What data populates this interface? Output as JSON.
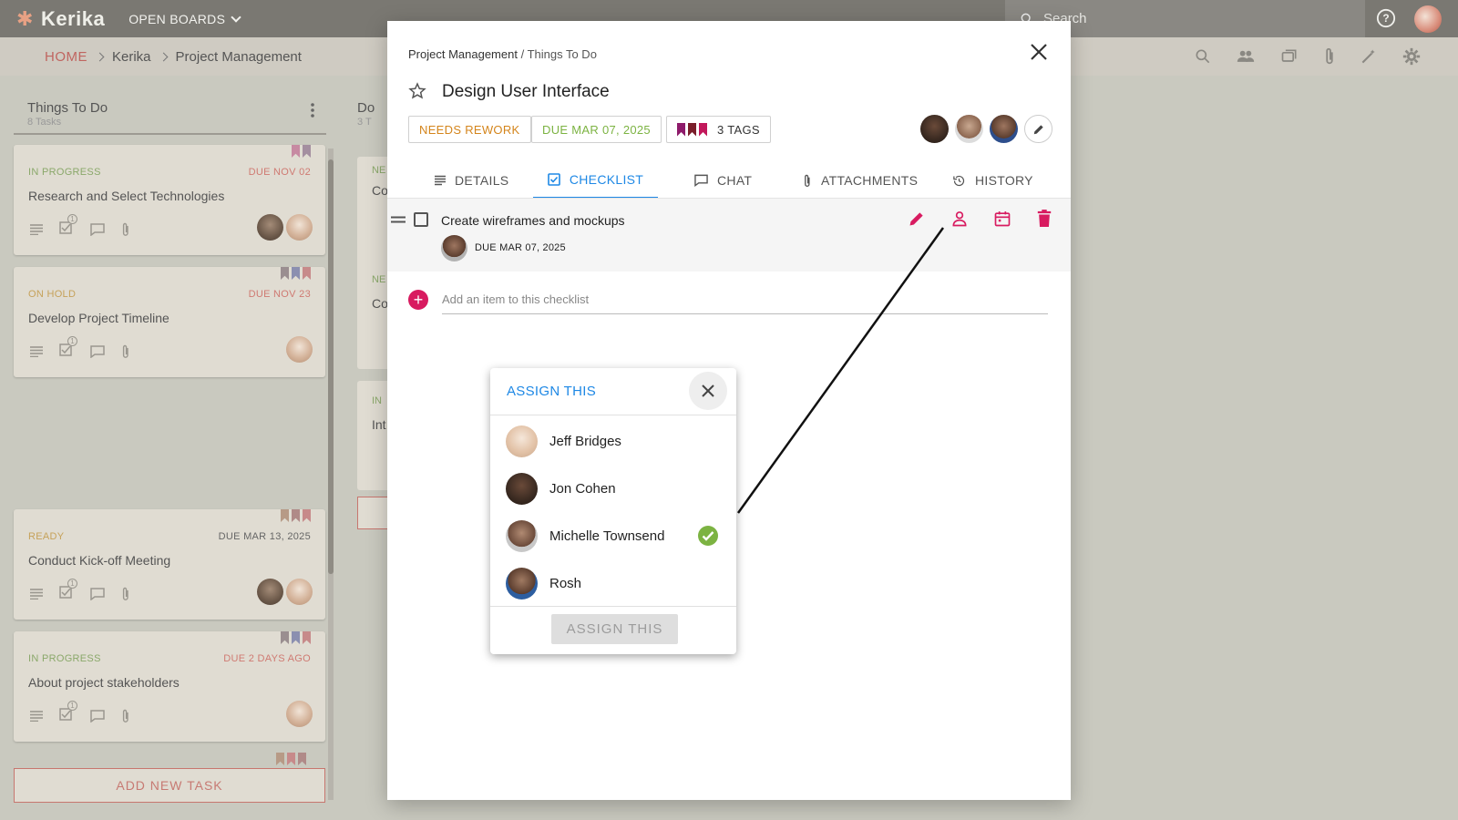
{
  "app": {
    "logo_text": "Kerika",
    "open_boards_label": "OPEN BOARDS",
    "search_placeholder": "Search"
  },
  "breadcrumb": {
    "home": "HOME",
    "org": "Kerika",
    "board": "Project Management"
  },
  "column": {
    "title": "Things To Do",
    "count": "8 Tasks",
    "cards": [
      {
        "status": "IN PROGRESS",
        "due": "DUE NOV 02",
        "title": "Research and Select Technologies",
        "checklist_count": "1"
      },
      {
        "status": "ON HOLD",
        "due": "DUE NOV 23",
        "title": "Develop Project Timeline",
        "checklist_count": "1"
      },
      {
        "status": "READY",
        "due": "DUE MAR 13, 2025",
        "title": "Conduct Kick-off Meeting",
        "checklist_count": "1"
      },
      {
        "status": "IN PROGRESS",
        "due": "DUE 2 DAYS AGO",
        "title": "About project stakeholders",
        "checklist_count": "1"
      }
    ],
    "add_task_label": "ADD NEW TASK"
  },
  "column2": {
    "title": "Do",
    "count": "3 T",
    "cards": [
      {
        "label": "NE",
        "title": "Co"
      },
      {
        "label": "NE",
        "title": "Co"
      },
      {
        "label": "IN",
        "title": "Int"
      }
    ]
  },
  "modal": {
    "crumb_board": "Project Management",
    "crumb_sep": " / ",
    "crumb_column": "Things To Do",
    "title": "Design User Interface",
    "chip_status": "NEEDS REWORK",
    "chip_due": "DUE MAR 07, 2025",
    "chip_tags": "3 TAGS",
    "tag_colors": [
      "#8e1b6b",
      "#7a1f2b",
      "#c2185b"
    ],
    "tabs": [
      {
        "label": "DETAILS",
        "icon": "notes-icon"
      },
      {
        "label": "CHECKLIST",
        "icon": "checkbox-icon",
        "active": true
      },
      {
        "label": "CHAT",
        "icon": "chat-icon"
      },
      {
        "label": "ATTACHMENTS",
        "icon": "paperclip-icon"
      },
      {
        "label": "HISTORY",
        "icon": "history-icon"
      }
    ],
    "checklist": {
      "item_text": "Create wireframes and mockups",
      "item_due": "DUE MAR 07, 2025",
      "add_placeholder": "Add an item to this checklist"
    }
  },
  "assign_popup": {
    "header": "ASSIGN THIS",
    "people": [
      {
        "name": "Jeff Bridges",
        "selected": false
      },
      {
        "name": "Jon Cohen",
        "selected": false
      },
      {
        "name": "Michelle Townsend",
        "selected": true
      },
      {
        "name": "Rosh",
        "selected": false
      }
    ],
    "button_label": "ASSIGN THIS"
  },
  "colors": {
    "accent_blue": "#1e88e5",
    "accent_pink": "#d81b60",
    "check_green": "#7cb342",
    "rework_orange": "#d4851c"
  }
}
